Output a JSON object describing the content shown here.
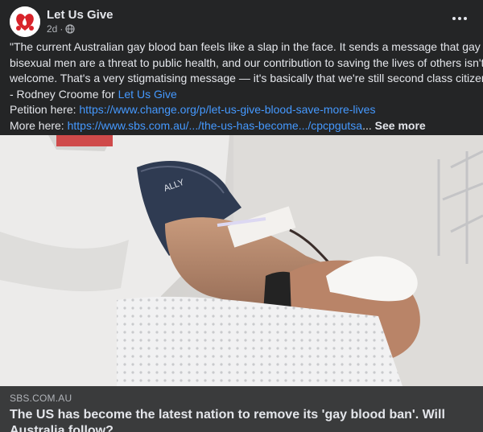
{
  "post": {
    "author": "Let Us Give",
    "time": "2d",
    "dot": "·",
    "privacy_icon": "globe-icon",
    "more_icon": "more-horizontal-icon",
    "avatar_icon": "heart-blood-drop-logo",
    "lines": [
      "\"The current Australian gay blood ban feels like a slap in the face. It sends a message that gay and",
      "bisexual men are a threat to public health, and our contribution to saving the lives of others isn't",
      "welcome. That's a very stigmatising message — it's basically that we're still second class citizens.\""
    ],
    "attribution_prefix": "- Rodney Croome for ",
    "attribution_link": "Let Us Give",
    "petition_label": "Petition here: ",
    "petition_url": "https://www.change.org/p/let-us-give-blood-save-more-lives",
    "more_label": "More here: ",
    "more_url": "https://www.sbs.com.au/.../the-us-has-become.../cpcpgutsa",
    "ellipsis": "...",
    "see_more": "See more"
  },
  "link_preview": {
    "domain": "SBS.COM.AU",
    "headline": "The US has become the latest nation to remove its 'gay blood ban'. Will Australia follow?"
  },
  "colors": {
    "background": "#242526",
    "link": "#4599ff",
    "preview_bg": "#3a3b3c"
  }
}
